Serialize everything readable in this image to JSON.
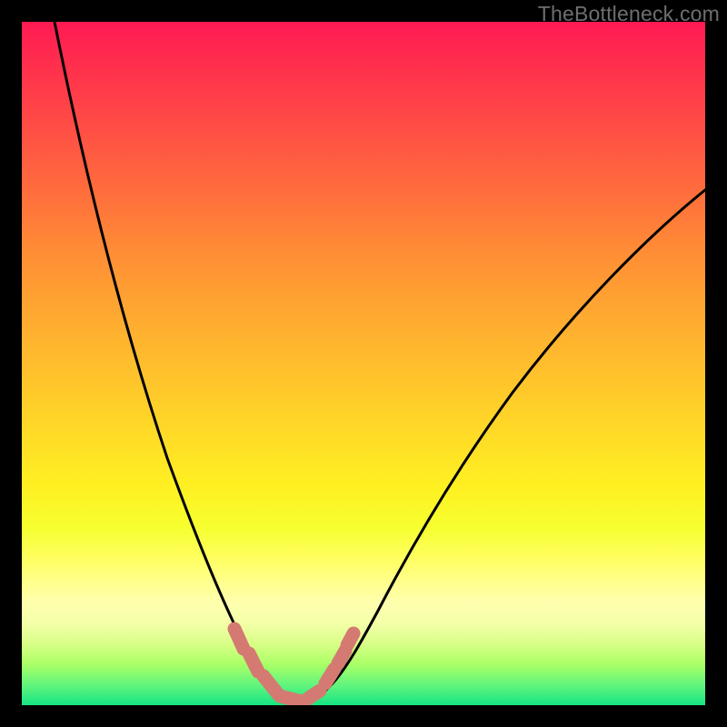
{
  "watermark": {
    "text": "TheBottleneck.com"
  },
  "chart_data": {
    "type": "line",
    "title": "",
    "xlabel": "",
    "ylabel": "",
    "xlim": [
      0,
      100
    ],
    "ylim": [
      0,
      100
    ],
    "grid": false,
    "legend": false,
    "series": [
      {
        "name": "bottleneck-curve",
        "color": "#000000",
        "x": [
          5,
          8,
          11,
          14,
          17,
          20,
          23,
          26,
          29,
          31,
          33,
          35,
          36.5,
          38,
          39.5,
          41,
          42.5,
          45,
          48,
          52,
          56,
          60,
          65,
          70,
          76,
          82,
          88,
          94,
          100
        ],
        "y": [
          100,
          89,
          78,
          67,
          57,
          47,
          38,
          29,
          21,
          15,
          10,
          6,
          3.5,
          2,
          1,
          0.5,
          1,
          3,
          7,
          13,
          20,
          27,
          35,
          43,
          51,
          59,
          66,
          72,
          78
        ]
      },
      {
        "name": "highlight-band",
        "color": "#d47a72",
        "x_range": [
          30,
          44
        ],
        "y_range": [
          0,
          20
        ],
        "note": "salmon overlay ticks near curve minimum"
      }
    ],
    "background_gradient": {
      "top": "#ff1a52",
      "bottom": "#16e582",
      "stops": [
        "red",
        "orange",
        "yellow",
        "green"
      ]
    }
  }
}
